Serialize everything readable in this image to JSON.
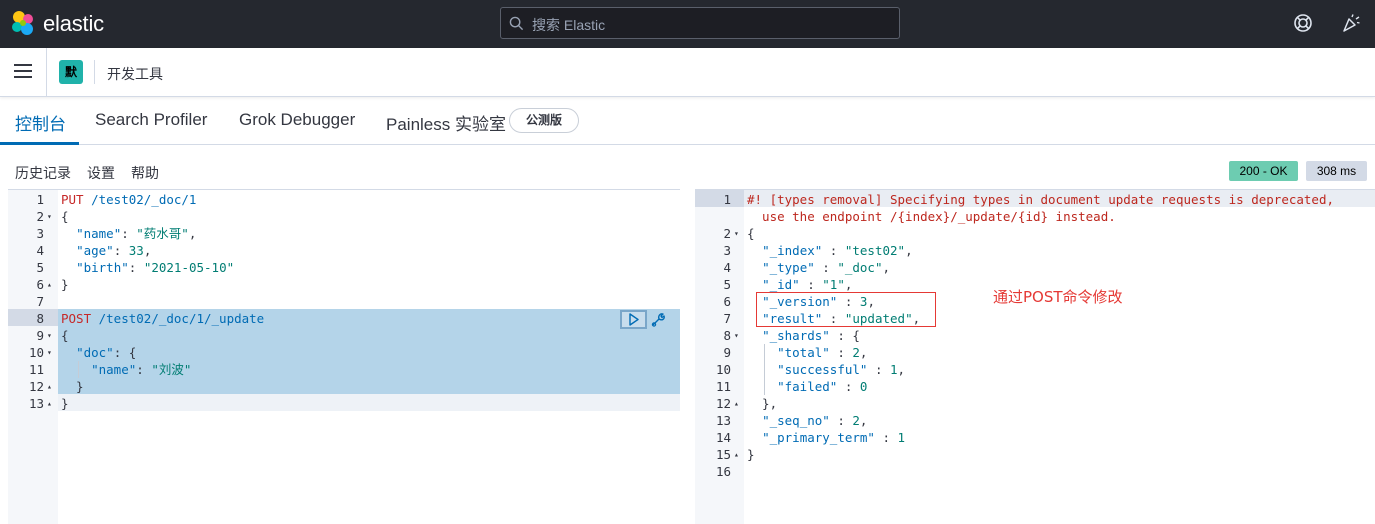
{
  "header": {
    "brand": "elastic",
    "search_placeholder": "搜索 Elastic"
  },
  "subheader": {
    "space_initial": "默",
    "breadcrumb": "开发工具"
  },
  "tabs": [
    {
      "label": "控制台",
      "active": true
    },
    {
      "label": "Search Profiler",
      "active": false
    },
    {
      "label": "Grok Debugger",
      "active": false
    },
    {
      "label": "Painless 实验室",
      "active": false
    }
  ],
  "beta_badge": "公测版",
  "toolbar": {
    "history": "历史记录",
    "settings": "设置",
    "help": "帮助",
    "status": "200 - OK",
    "time": "308 ms"
  },
  "request_editor": {
    "lines": [
      {
        "n": "1",
        "fold": ""
      },
      {
        "n": "2",
        "fold": "▾"
      },
      {
        "n": "3",
        "fold": ""
      },
      {
        "n": "4",
        "fold": ""
      },
      {
        "n": "5",
        "fold": ""
      },
      {
        "n": "6",
        "fold": "▴"
      },
      {
        "n": "7",
        "fold": ""
      },
      {
        "n": "8",
        "fold": ""
      },
      {
        "n": "9",
        "fold": "▾"
      },
      {
        "n": "10",
        "fold": "▾"
      },
      {
        "n": "11",
        "fold": ""
      },
      {
        "n": "12",
        "fold": "▴"
      },
      {
        "n": "13",
        "fold": "▴"
      }
    ],
    "put_method": "PUT",
    "put_url": " /test02/_doc/1",
    "name_key": "\"name\"",
    "name_val": "\"药水哥\"",
    "age_key": "\"age\"",
    "age_val": "33",
    "birth_key": "\"birth\"",
    "birth_val": "\"2021-05-10\"",
    "post_method": "POST",
    "post_url": " /test02/_doc/1/_update",
    "doc_key": "\"doc\"",
    "name2_key": "\"name\"",
    "name2_val": "\"刘波\""
  },
  "response_editor": {
    "lines": [
      {
        "n": "1",
        "fold": ""
      },
      {
        "n": "2",
        "fold": "▾"
      },
      {
        "n": "3",
        "fold": ""
      },
      {
        "n": "4",
        "fold": ""
      },
      {
        "n": "5",
        "fold": ""
      },
      {
        "n": "6",
        "fold": ""
      },
      {
        "n": "7",
        "fold": ""
      },
      {
        "n": "8",
        "fold": "▾"
      },
      {
        "n": "9",
        "fold": ""
      },
      {
        "n": "10",
        "fold": ""
      },
      {
        "n": "11",
        "fold": ""
      },
      {
        "n": "12",
        "fold": "▴"
      },
      {
        "n": "13",
        "fold": ""
      },
      {
        "n": "14",
        "fold": ""
      },
      {
        "n": "15",
        "fold": "▴"
      },
      {
        "n": "16",
        "fold": ""
      }
    ],
    "warning_1": "#! [types removal] Specifying types in document update requests is deprecated,",
    "warning_2": "  use the endpoint /{index}/_update/{id} instead.",
    "index_key": "\"_index\"",
    "index_val": "\"test02\"",
    "type_key": "\"_type\"",
    "type_val": "\"_doc\"",
    "id_key": "\"_id\"",
    "id_val": "\"1\"",
    "version_key": "\"_version\"",
    "version_val": "3",
    "result_key": "\"result\"",
    "result_val": "\"updated\"",
    "shards_key": "\"_shards\"",
    "total_key": "\"total\"",
    "total_val": "2",
    "successful_key": "\"successful\"",
    "successful_val": "1",
    "failed_key": "\"failed\"",
    "failed_val": "0",
    "seq_key": "\"_seq_no\"",
    "seq_val": "2",
    "term_key": "\"_primary_term\"",
    "term_val": "1"
  },
  "annotation": "通过POST命令修改"
}
